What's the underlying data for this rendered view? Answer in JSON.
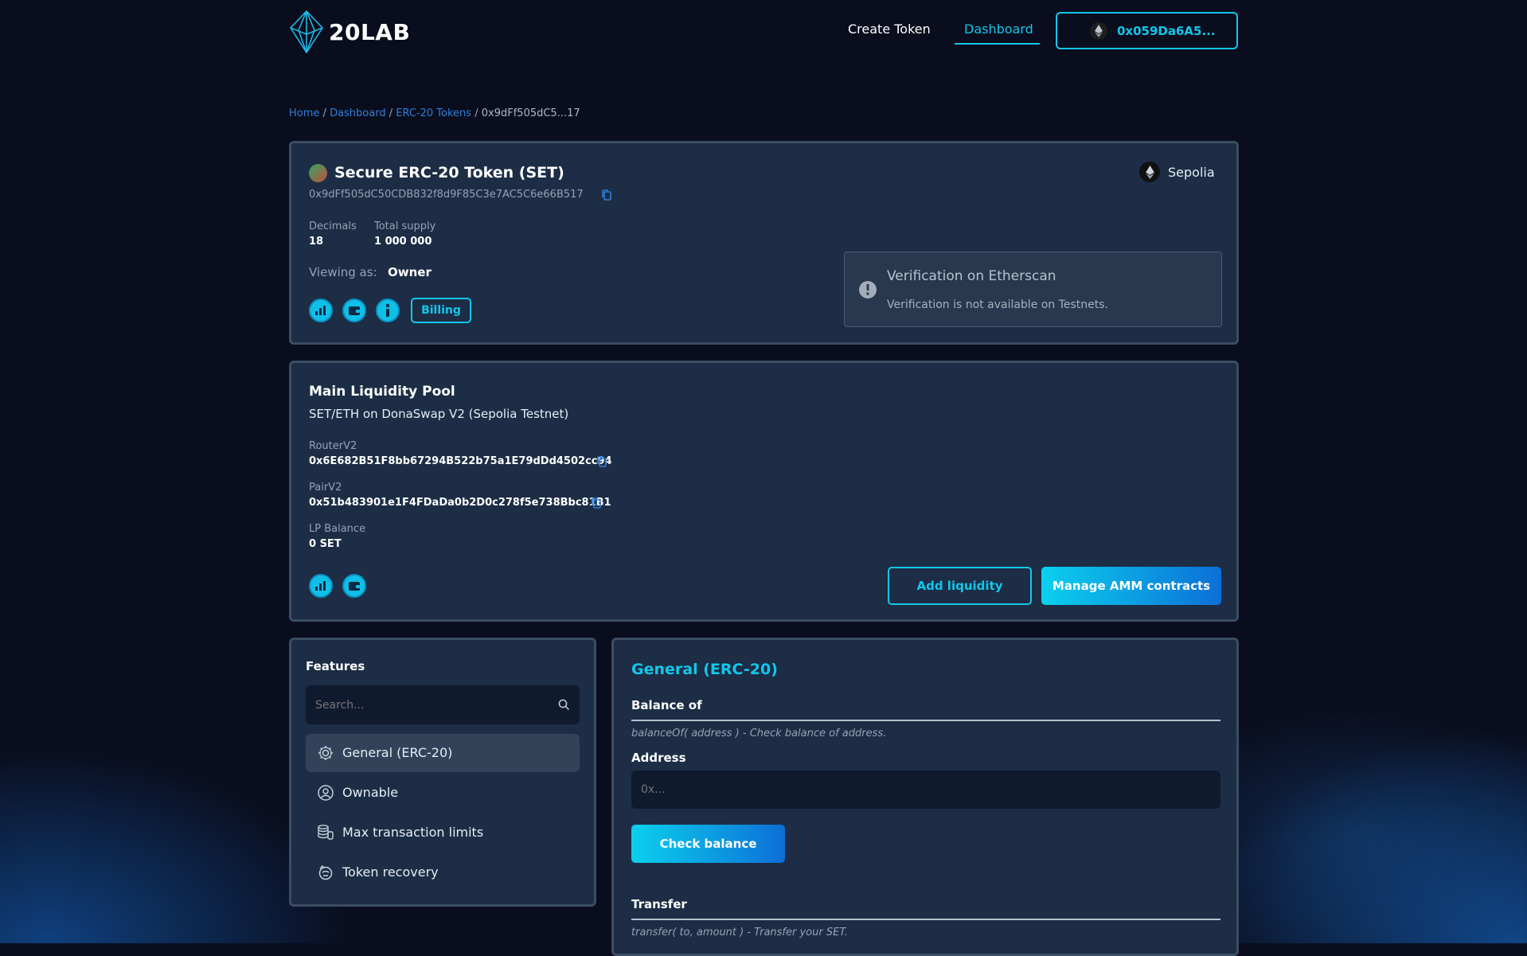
{
  "brand": {
    "name": "20LAB"
  },
  "nav": {
    "create_token": "Create Token",
    "dashboard": "Dashboard",
    "wallet": "0x059Da6A5..."
  },
  "breadcrumb": {
    "items": [
      "Home",
      "Dashboard",
      "ERC-20 Tokens"
    ],
    "separator": "/",
    "current": "0x9dFf505dC5...17"
  },
  "token": {
    "name": "Secure ERC-20 Token (SET)",
    "address": "0x9dFf505dC50CDB832f8d9F85C3e7AC5C6e66B517",
    "network": "Sepolia",
    "decimals_label": "Decimals",
    "decimals": "18",
    "supply_label": "Total supply",
    "supply": "1 000 000",
    "viewing_label": "Viewing as:",
    "viewing_role": "Owner",
    "billing": "Billing"
  },
  "verification": {
    "title": "Verification on Etherscan",
    "message": "Verification is not available on Testnets."
  },
  "pool": {
    "title": "Main Liquidity Pool",
    "subtitle": "SET/ETH on DonaSwap V2 (Sepolia Testnet)",
    "router_label": "RouterV2",
    "router": "0x6E682B51F8bb67294B522b75a1E79dDd4502cc94",
    "pair_label": "PairV2",
    "pair": "0x51b483901e1F4FDaDa0b2D0c278f5e738Bbc81B1",
    "lp_label": "LP Balance",
    "lp_value": "0 SET",
    "add_liquidity": "Add liquidity",
    "manage_amm": "Manage AMM contracts"
  },
  "features": {
    "title": "Features",
    "search_placeholder": "Search...",
    "items": [
      {
        "label": "General (ERC-20)",
        "icon": "gear-icon",
        "active": true
      },
      {
        "label": "Ownable",
        "icon": "user-icon"
      },
      {
        "label": "Max transaction limits",
        "icon": "coins-icon"
      },
      {
        "label": "Token recovery",
        "icon": "recovery-icon"
      }
    ]
  },
  "general": {
    "title": "General (ERC-20)",
    "balance_title": "Balance of",
    "balance_desc": "balanceOf( address ) - Check balance of address.",
    "address_label": "Address",
    "address_placeholder": "0x...",
    "check_button": "Check balance",
    "transfer_title": "Transfer",
    "transfer_desc": "transfer( to, amount ) - Transfer your SET."
  },
  "colors": {
    "accent": "#12c7ea",
    "link": "#2f7fd8",
    "card": "#1c2d45",
    "background": "#0a0d1d"
  }
}
